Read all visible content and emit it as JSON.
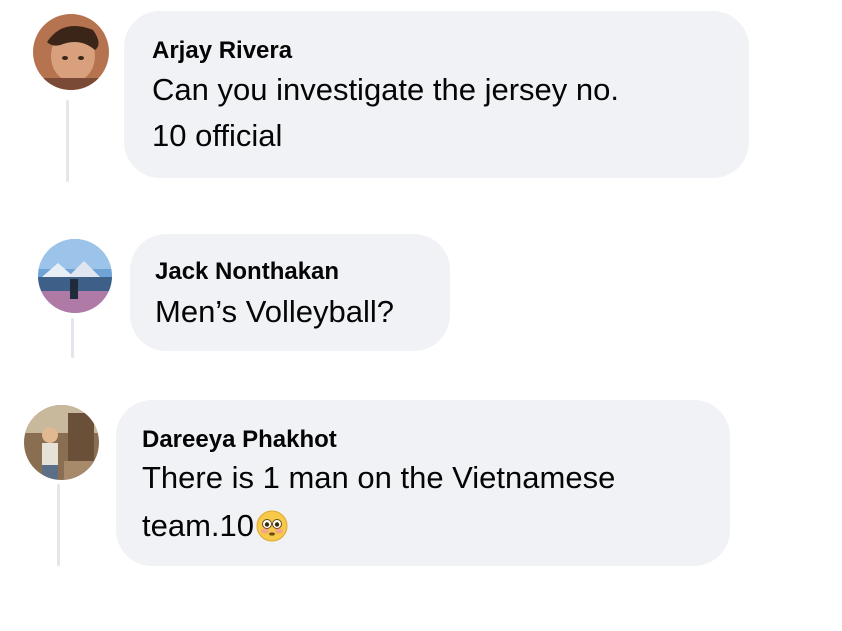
{
  "comments": [
    {
      "author": "Arjay Rivera",
      "text_line1": "Can you investigate the jersey no.",
      "text_line2": "10 official",
      "avatar_icon": "profile-photo"
    },
    {
      "author": "Jack Nonthakan",
      "text_line1": "Men’s Volleyball?",
      "avatar_icon": "profile-photo"
    },
    {
      "author": "Dareeya Phakhot",
      "text_line1": "There is 1 man on the Vietnamese",
      "text_line2": "team.10",
      "emoji": "flushed-face-emoji",
      "avatar_icon": "profile-photo"
    }
  ],
  "colors": {
    "bubble": "#f0f2f5",
    "text": "#050505",
    "thread_line": "#e4e6eb"
  }
}
